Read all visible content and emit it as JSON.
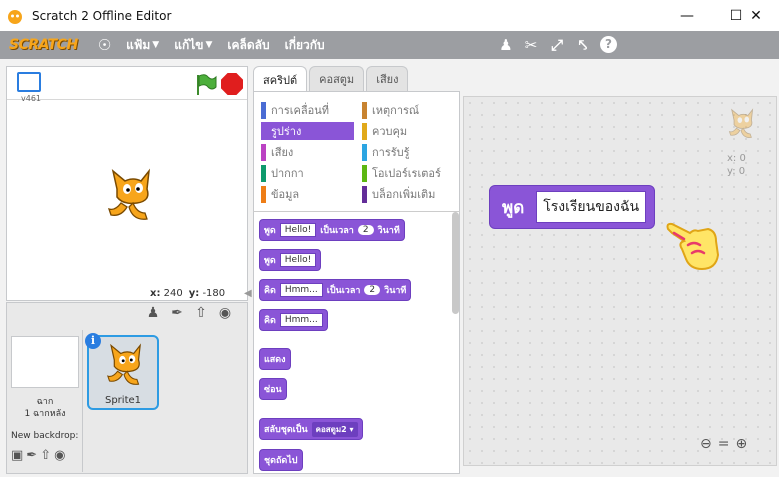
{
  "window": {
    "title": "Scratch 2 Offline Editor"
  },
  "menubar": {
    "logo": "SCRATCH",
    "items": [
      {
        "label": "แฟ้ม",
        "caret": "▼"
      },
      {
        "label": "แก้ไข",
        "caret": "▼"
      },
      {
        "label": "เคล็ดลับ",
        "caret": ""
      },
      {
        "label": "เกี่ยวกับ",
        "caret": ""
      }
    ]
  },
  "stage": {
    "version": "v461",
    "coords": {
      "x_label": "x:",
      "x": "240",
      "y_label": "y:",
      "y": "-180"
    }
  },
  "sprites_pane": {
    "stage_label": "ฉาก",
    "backdrop_count": "1 ฉากหลัง",
    "new_backdrop": "New backdrop:",
    "sprite_name": "Sprite1",
    "info": "i"
  },
  "tabs": [
    {
      "label": "สคริปต์",
      "active": true
    },
    {
      "label": "คอสตูม",
      "active": false
    },
    {
      "label": "เสียง",
      "active": false
    }
  ],
  "categories": [
    {
      "label": "การเคลื่อนที่",
      "color": "#4a6cd4"
    },
    {
      "label": "รูปร่าง",
      "color": "#8a55d7",
      "selected": true
    },
    {
      "label": "เสียง",
      "color": "#bb42c3"
    },
    {
      "label": "ปากกา",
      "color": "#0e9a6c"
    },
    {
      "label": "ข้อมูล",
      "color": "#ee7d16"
    },
    {
      "label": "เหตุการณ์",
      "color": "#c88330"
    },
    {
      "label": "ควบคุม",
      "color": "#e1a91a"
    },
    {
      "label": "การรับรู้",
      "color": "#2ca5e2"
    },
    {
      "label": "โอเปอร์เรเตอร์",
      "color": "#5cb712"
    },
    {
      "label": "บล็อกเพิ่มเติม",
      "color": "#632d99"
    }
  ],
  "blocks": {
    "say_for": {
      "label": "พูด",
      "text": "Hello!",
      "mid": "เป็นเวลา",
      "num": "2",
      "unit": "วินาที"
    },
    "say": {
      "label": "พูด",
      "text": "Hello!"
    },
    "think_for": {
      "label": "คิด",
      "text": "Hmm...",
      "mid": "เป็นเวลา",
      "num": "2",
      "unit": "วินาที"
    },
    "think": {
      "label": "คิด",
      "text": "Hmm..."
    },
    "show": {
      "label": "แสดง"
    },
    "hide": {
      "label": "ซ่อน"
    },
    "switch_costume": {
      "label": "สลับชุดเป็น",
      "value": "คอสตูม2"
    },
    "next_costume": {
      "label": "ชุดถัดไป"
    }
  },
  "script": {
    "label": "พูด",
    "value": "โรงเรียนของฉัน"
  },
  "sprite_info": {
    "x": "x: 0",
    "y": "y: 0"
  }
}
